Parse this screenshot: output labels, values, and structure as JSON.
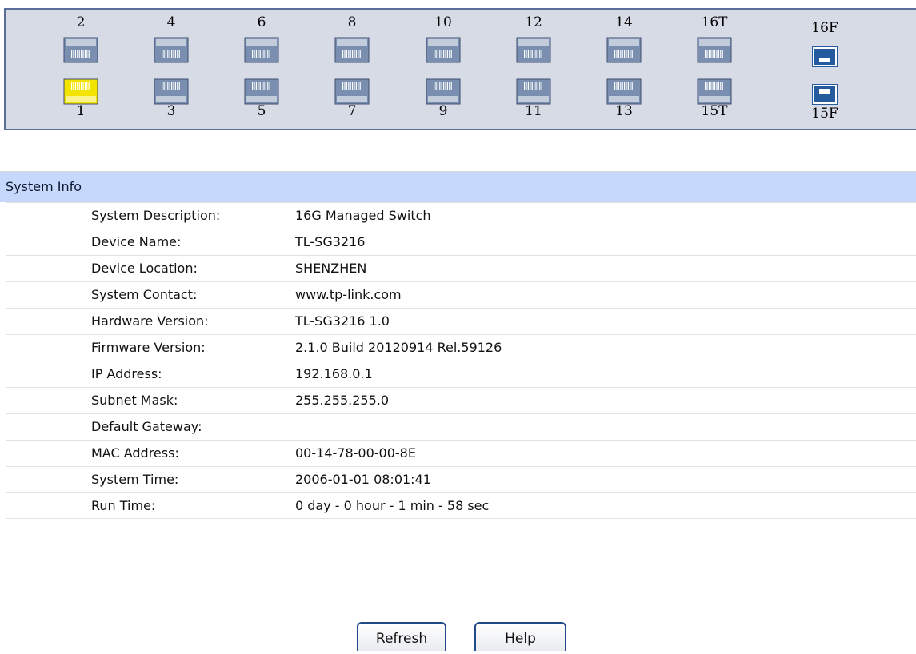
{
  "ports": {
    "top_labels": [
      "2",
      "4",
      "6",
      "8",
      "10",
      "12",
      "14",
      "16T"
    ],
    "bottom_labels": [
      "1",
      "3",
      "5",
      "7",
      "9",
      "11",
      "13",
      "15T"
    ],
    "sfp_top_label": "16F",
    "sfp_bottom_label": "15F",
    "active_port": "1",
    "colors": {
      "active": "#f3e400",
      "inactive": "#7a8fb0",
      "sfp": "#245a9e"
    }
  },
  "system_info": {
    "title": "System Info",
    "rows": [
      {
        "label": "System Description:",
        "value": "16G Managed Switch"
      },
      {
        "label": "Device Name:",
        "value": "TL-SG3216"
      },
      {
        "label": "Device Location:",
        "value": "SHENZHEN"
      },
      {
        "label": "System Contact:",
        "value": "www.tp-link.com"
      },
      {
        "label": "Hardware Version:",
        "value": "TL-SG3216 1.0"
      },
      {
        "label": "Firmware Version:",
        "value": "2.1.0 Build 20120914 Rel.59126"
      },
      {
        "label": "IP Address:",
        "value": "192.168.0.1"
      },
      {
        "label": "Subnet Mask:",
        "value": "255.255.255.0"
      },
      {
        "label": "Default Gateway:",
        "value": ""
      },
      {
        "label": "MAC Address:",
        "value": "00-14-78-00-00-8E"
      },
      {
        "label": "System Time:",
        "value": "2006-01-01 08:01:41"
      },
      {
        "label": "Run Time:",
        "value": "0 day - 0 hour - 1 min - 58 sec"
      }
    ]
  },
  "buttons": {
    "refresh_label": "Refresh",
    "help_label": "Help"
  }
}
